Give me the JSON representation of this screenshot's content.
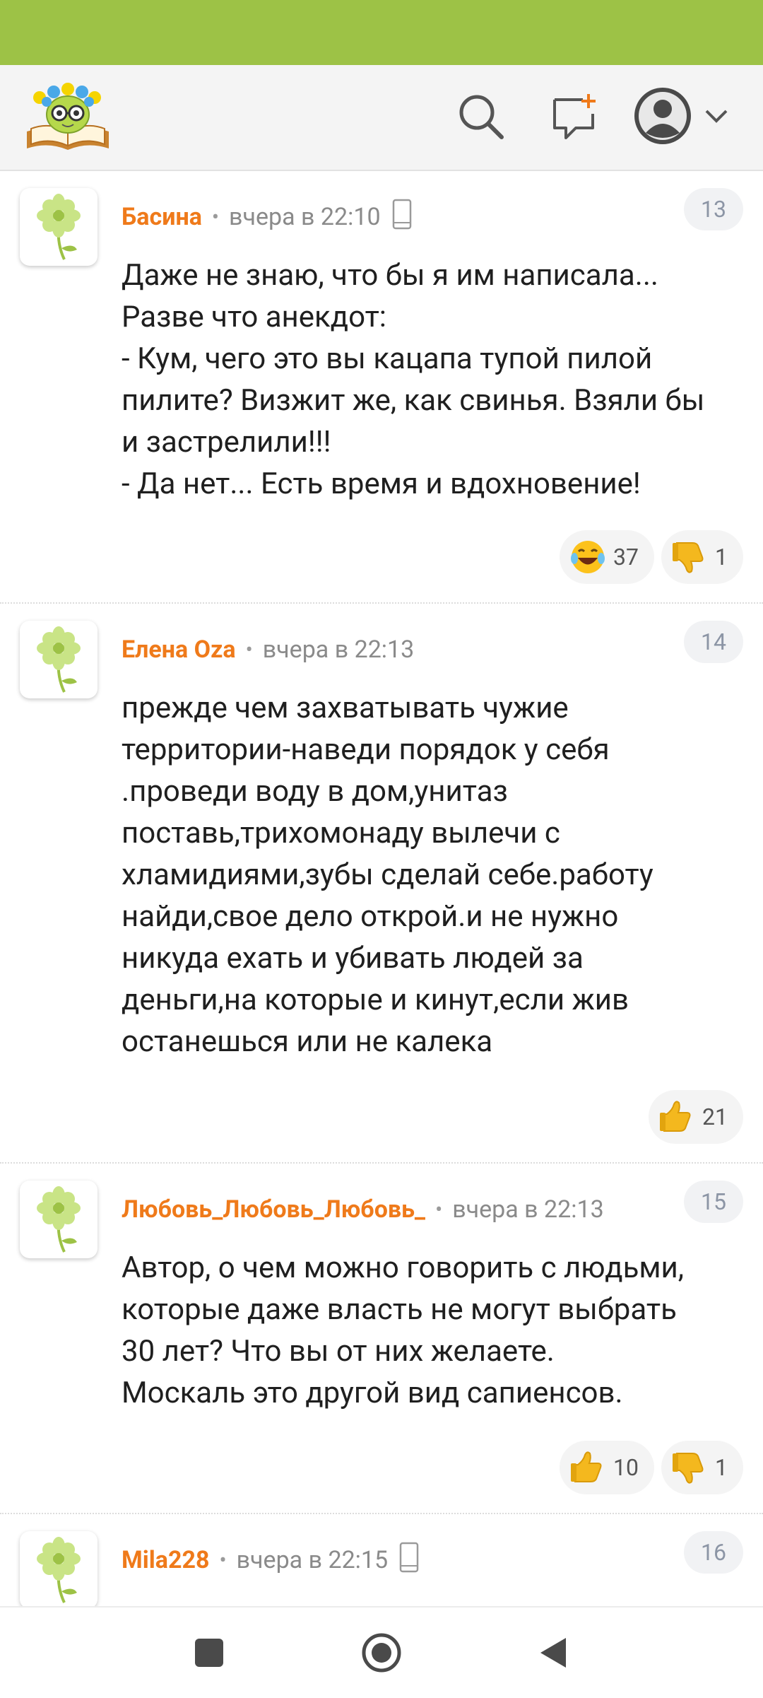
{
  "app": {
    "name": "Odnoklassniki",
    "accent_color": "#9dc246",
    "author_color": "#ef7a1a",
    "header_icons": [
      "logo-reader-icon",
      "search-icon",
      "new-message-icon",
      "profile-avatar-icon",
      "chevron-down-icon"
    ]
  },
  "comments": [
    {
      "author": "Басина",
      "time": "вчера в 22:10",
      "device_icon": "phone-icon",
      "number": "13",
      "lines": [
        "Даже не знаю, что бы я им написала...",
        "Разве что анекдот:",
        "- Кум, чего это вы кацапа тупой пилой",
        "пилите? Визжит же, как свинья. Взяли бы",
        "и застрелили!!!",
        "- Да нет... Есть время и вдохновение!"
      ],
      "reactions": [
        {
          "icon": "laughing-emoji-icon",
          "count": "37"
        },
        {
          "icon": "thumbs-down-icon",
          "count": "1"
        }
      ]
    },
    {
      "author": "Елена Oza",
      "time": "вчера в 22:13",
      "number": "14",
      "lines": [
        "прежде чем захватывать чужие",
        "территории-наведи порядок у себя",
        ".проведи воду в дом,унитаз",
        "поставь,трихомонаду вылечи с",
        "хламидиями,зубы сделай себе.работу",
        "найди,свое дело открой.и не нужно",
        "никуда ехать и убивать людей за",
        "деньги,на которые и кинут,если жив",
        "останешься или не калека"
      ],
      "reactions": [
        {
          "icon": "thumbs-up-icon",
          "count": "21"
        }
      ]
    },
    {
      "author": "Любовь_Любовь_Любовь_",
      "time": "вчера в 22:13",
      "number": "15",
      "lines": [
        "Автор, о чем можно говорить с людьми,",
        "которые даже власть не могут выбрать",
        "30 лет? Что вы от них желаете.",
        "Москаль это другой вид сапиенсов."
      ],
      "reactions": [
        {
          "icon": "thumbs-up-icon",
          "count": "10"
        },
        {
          "icon": "thumbs-down-icon",
          "count": "1"
        }
      ]
    },
    {
      "author": "Mila228",
      "time": "вчера в 22:15",
      "device_icon": "phone-icon",
      "number": "16",
      "lines": []
    }
  ],
  "navbar": {
    "buttons": [
      "recent-apps-icon",
      "home-icon",
      "back-icon"
    ]
  }
}
